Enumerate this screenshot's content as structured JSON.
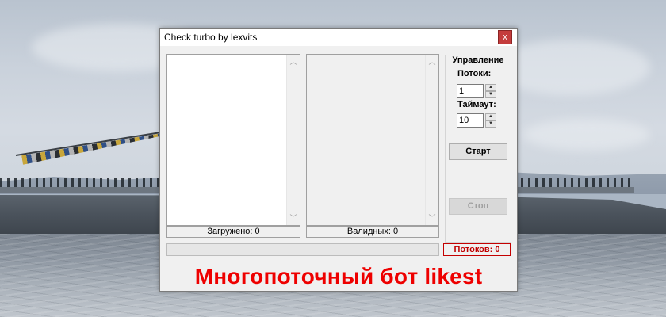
{
  "window": {
    "title": "Check turbo by lexvits",
    "close_icon": "close-icon",
    "close_glyph": "x"
  },
  "lists": {
    "loaded_status": "Загружено: 0",
    "valid_status": "Валидных: 0",
    "scroll_up_glyph": "︿",
    "scroll_down_glyph": "﹀"
  },
  "control": {
    "group_title": "Управление",
    "threads_label": "Потоки:",
    "threads_value": "1",
    "timeout_label": "Таймаут:",
    "timeout_value": "10",
    "spin_up_glyph": "▲",
    "spin_down_glyph": "▼",
    "start_label": "Старт",
    "stop_label": "Стоп"
  },
  "footer": {
    "progress": 0,
    "threads_count_label": "Потоков: 0"
  },
  "banner": {
    "text": "Многопоточный бот likest"
  },
  "colors": {
    "banner": "#ee0000",
    "badge": "#c00000",
    "close_button": "#c43c3c"
  }
}
